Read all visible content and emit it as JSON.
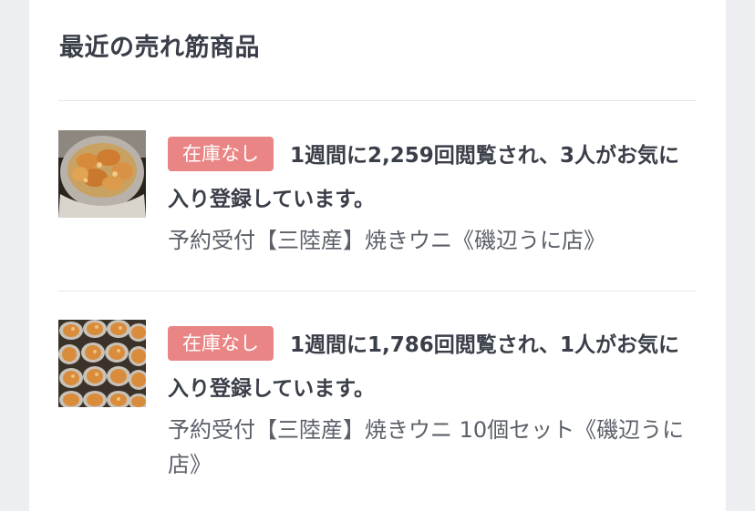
{
  "section": {
    "title": "最近の売れ筋商品"
  },
  "items": [
    {
      "badge": "在庫なし",
      "stats": "1週間に2,259回閲覧され、3人がお気に入り登録しています。",
      "name": "予約受付【三陸産】焼きウニ《磯辺うに店》",
      "image_icon": "grilled-sea-urchin-photo"
    },
    {
      "badge": "在庫なし",
      "stats": "1週間に1,786回閲覧され、1人がお気に入り登録しています。",
      "name": "予約受付【三陸産】焼きウニ 10個セット《磯辺うに店》",
      "image_icon": "grilled-sea-urchin-set-photo"
    }
  ],
  "colors": {
    "badge_bg": "#ea8585",
    "text_dark": "#3a3e48",
    "text_muted": "#5b5f68",
    "divider": "#e6e7eb",
    "page_bg": "#eceef2"
  }
}
